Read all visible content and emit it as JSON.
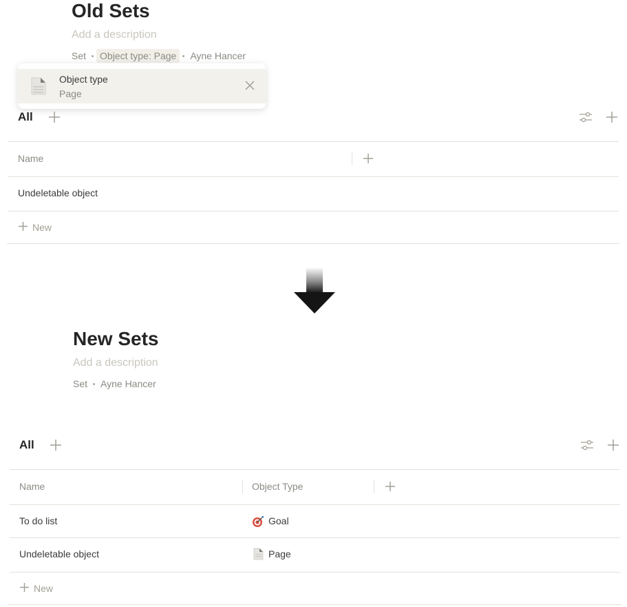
{
  "old": {
    "title": "Old Sets",
    "description_placeholder": "Add a description",
    "meta": {
      "type": "Set",
      "filter": "Object type: Page",
      "author": "Ayne Hancer"
    },
    "popup": {
      "label": "Object type",
      "value": "Page"
    },
    "view": {
      "name": "All"
    },
    "columns": [
      "Name"
    ],
    "rows": [
      {
        "name": "Undeletable object"
      }
    ],
    "new_label": "New"
  },
  "new": {
    "title": "New Sets",
    "description_placeholder": "Add a description",
    "meta": {
      "type": "Set",
      "author": "Ayne Hancer"
    },
    "view": {
      "name": "All"
    },
    "columns": [
      "Name",
      "Object Type"
    ],
    "rows": [
      {
        "name": "To do list",
        "object_type": "Goal",
        "icon": "goal-icon"
      },
      {
        "name": "Undeletable object",
        "object_type": "Page",
        "icon": "page-icon"
      }
    ],
    "new_label": "New"
  },
  "colors": {
    "text": "#252525",
    "muted": "#8b8a84",
    "placeholder": "#c8c6bd",
    "divider": "#e3e1db",
    "chip": "#f1efe8"
  }
}
